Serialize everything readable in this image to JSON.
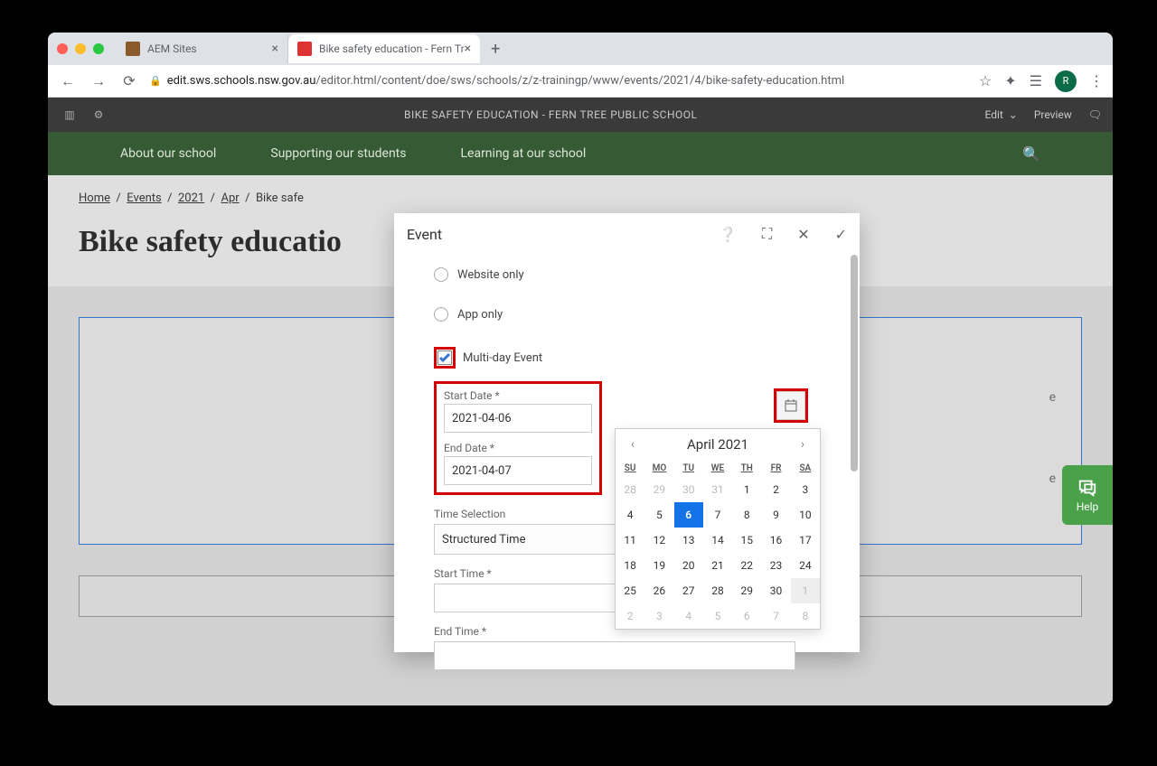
{
  "browser": {
    "tabs": [
      {
        "title": "AEM Sites",
        "active": false
      },
      {
        "title": "Bike safety education - Fern Tr",
        "active": true
      }
    ],
    "url_host": "edit.sws.schools.nsw.gov.au",
    "url_path": "/editor.html/content/doe/sws/schools/z/z-trainingp/www/events/2021/4/bike-safety-education.html",
    "avatar_initial": "R"
  },
  "aem_bar": {
    "title": "BIKE SAFETY EDUCATION - FERN TREE PUBLIC SCHOOL",
    "edit_label": "Edit",
    "preview_label": "Preview"
  },
  "site_nav": {
    "items": [
      "About our school",
      "Supporting our students",
      "Learning at our school"
    ]
  },
  "breadcrumbs": {
    "items": [
      "Home",
      "Events",
      "2021",
      "Apr"
    ],
    "current": "Bike safe"
  },
  "page": {
    "title": "Bike safety educatio",
    "content_snippet_1": "e",
    "content_snippet_2": "e"
  },
  "modal": {
    "title": "Event",
    "radio_website": "Website only",
    "radio_app": "App only",
    "checkbox_multiday": "Multi-day Event",
    "start_date_label": "Start Date *",
    "start_date_value": "2021-04-06",
    "end_date_label": "End Date *",
    "end_date_value": "2021-04-07",
    "time_selection_label": "Time Selection",
    "time_selection_value": "Structured Time",
    "start_time_label": "Start Time *",
    "end_time_label": "End Time *"
  },
  "datepicker": {
    "month_label": "April 2021",
    "dow": [
      "SU",
      "MO",
      "TU",
      "WE",
      "TH",
      "FR",
      "SA"
    ],
    "rows": [
      [
        {
          "d": "28",
          "m": true
        },
        {
          "d": "29",
          "m": true
        },
        {
          "d": "30",
          "m": true
        },
        {
          "d": "31",
          "m": true
        },
        {
          "d": "1"
        },
        {
          "d": "2"
        },
        {
          "d": "3"
        }
      ],
      [
        {
          "d": "4"
        },
        {
          "d": "5"
        },
        {
          "d": "6",
          "sel": true
        },
        {
          "d": "7"
        },
        {
          "d": "8"
        },
        {
          "d": "9"
        },
        {
          "d": "10"
        }
      ],
      [
        {
          "d": "11"
        },
        {
          "d": "12"
        },
        {
          "d": "13"
        },
        {
          "d": "14"
        },
        {
          "d": "15"
        },
        {
          "d": "16"
        },
        {
          "d": "17"
        }
      ],
      [
        {
          "d": "18"
        },
        {
          "d": "19"
        },
        {
          "d": "20"
        },
        {
          "d": "21"
        },
        {
          "d": "22"
        },
        {
          "d": "23"
        },
        {
          "d": "24"
        }
      ],
      [
        {
          "d": "25"
        },
        {
          "d": "26"
        },
        {
          "d": "27"
        },
        {
          "d": "28"
        },
        {
          "d": "29"
        },
        {
          "d": "30"
        },
        {
          "d": "1",
          "m": true,
          "hl": true
        }
      ],
      [
        {
          "d": "2",
          "m": true
        },
        {
          "d": "3",
          "m": true
        },
        {
          "d": "4",
          "m": true
        },
        {
          "d": "5",
          "m": true
        },
        {
          "d": "6",
          "m": true
        },
        {
          "d": "7",
          "m": true
        },
        {
          "d": "8",
          "m": true
        }
      ]
    ]
  },
  "help": {
    "label": "Help"
  }
}
